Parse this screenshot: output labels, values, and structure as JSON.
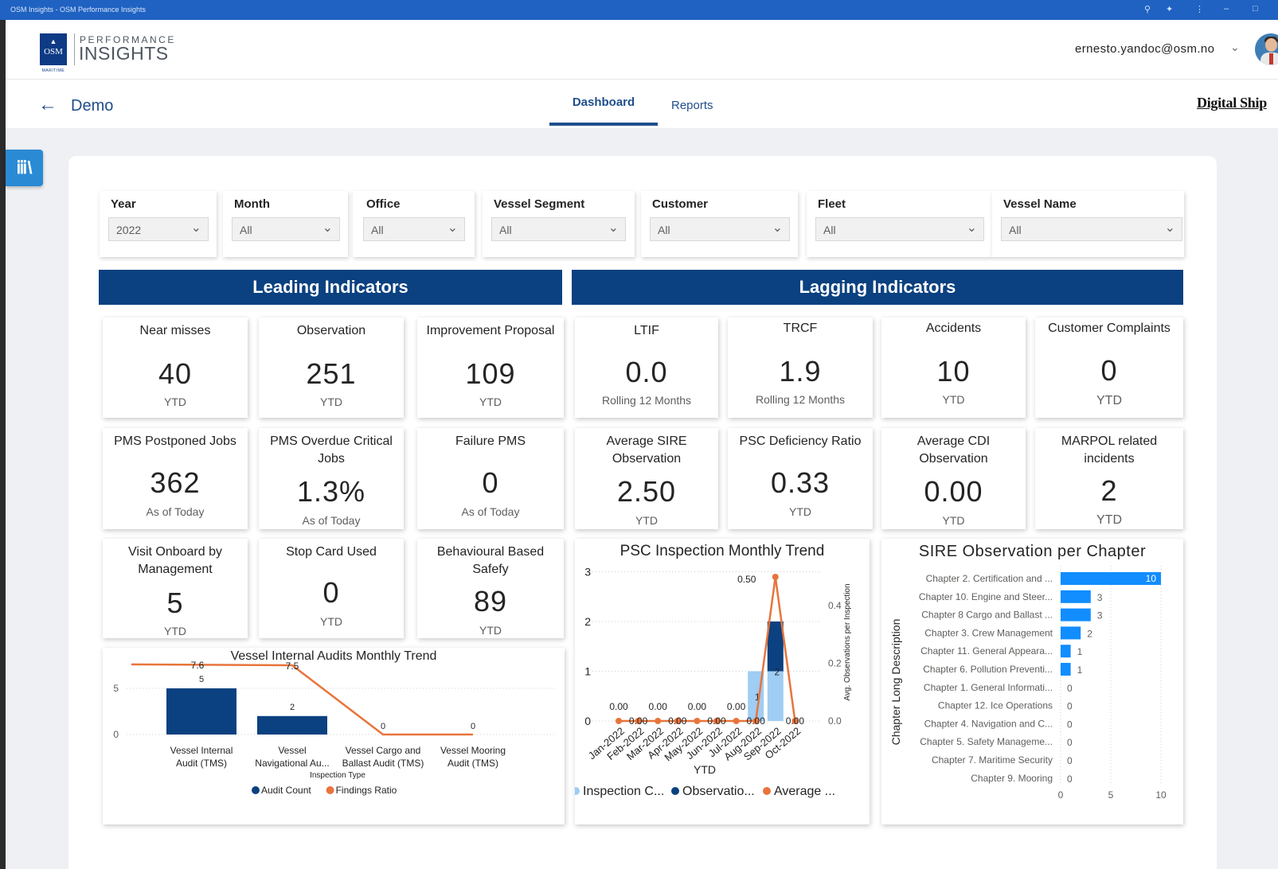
{
  "window": {
    "title": "OSM Insights - OSM Performance Insights"
  },
  "header": {
    "logo": {
      "mark": "OSM",
      "maritime": "MARITIME",
      "line1": "PERFORMANCE",
      "line2": "INSIGHTS"
    },
    "user_email": "ernesto.yandoc@osm.no"
  },
  "subnav": {
    "report_name": "Demo",
    "tabs": [
      "Dashboard",
      "Reports"
    ],
    "active_tab": "Dashboard",
    "partner_logo": "Digital Ship"
  },
  "slicers": [
    {
      "title": "Year",
      "value": "2022"
    },
    {
      "title": "Month",
      "value": "All"
    },
    {
      "title": "Office",
      "value": "All"
    },
    {
      "title": "Vessel Segment",
      "value": "All"
    },
    {
      "title": "Customer",
      "value": "All"
    },
    {
      "title": "Fleet",
      "value": "All"
    },
    {
      "title": "Vessel Name",
      "value": "All"
    }
  ],
  "sections": {
    "leading": "Leading Indicators",
    "lagging": "Lagging Indicators"
  },
  "kpis": {
    "near_misses": {
      "title": "Near misses",
      "value": "40",
      "sub": "YTD"
    },
    "observation": {
      "title": "Observation",
      "value": "251",
      "sub": "YTD"
    },
    "improvement": {
      "title": "Improvement Proposal",
      "value": "109",
      "sub": "YTD"
    },
    "ltif": {
      "title": "LTIF",
      "value": "0.0",
      "sub": "Rolling 12 Months"
    },
    "trcf": {
      "title": "TRCF",
      "value": "1.9",
      "sub": "Rolling 12 Months"
    },
    "accidents": {
      "title": "Accidents",
      "value": "10",
      "sub": "YTD"
    },
    "complaints": {
      "title": "Customer Complaints",
      "value": "0",
      "sub": "YTD"
    },
    "pms_postponed": {
      "title": "PMS Postponed Jobs",
      "value": "362",
      "sub": "As of Today"
    },
    "pms_overdue": {
      "title": "PMS Overdue Critical Jobs",
      "value": "1.3%",
      "sub": "As of Today"
    },
    "failure_pms": {
      "title": "Failure PMS",
      "value": "0",
      "sub": "As of Today"
    },
    "avg_sire": {
      "title": "Average SIRE Observation",
      "value": "2.50",
      "sub": "YTD"
    },
    "psc_ratio": {
      "title": "PSC Deficiency Ratio",
      "value": "0.33",
      "sub": "YTD"
    },
    "avg_cdi": {
      "title": "Average CDI Observation",
      "value": "0.00",
      "sub": "YTD"
    },
    "marpol": {
      "title": "MARPOL related incidents",
      "value": "2",
      "sub": "YTD"
    },
    "visit": {
      "title": "Visit Onboard by Management",
      "value": "5",
      "sub": "YTD"
    },
    "stop_card": {
      "title": "Stop Card Used",
      "value": "0",
      "sub": "YTD"
    },
    "bbs": {
      "title": "Behavioural Based Safefy",
      "value": "89",
      "sub": "YTD"
    }
  },
  "chart_data": [
    {
      "id": "audits",
      "type": "bar",
      "title": "Vessel Internal Audits Monthly Trend",
      "xlabel": "Inspection Type",
      "categories": [
        "Vessel Internal Audit (TMS)",
        "Vessel Navigational Au...",
        "Vessel Cargo and Ballast Audit (TMS)",
        "Vessel Mooring Audit (TMS)"
      ],
      "category_lines": [
        [
          "Vessel Internal",
          "Audit (TMS)"
        ],
        [
          "Vessel",
          "Navigational Au..."
        ],
        [
          "Vessel Cargo and",
          "Ballast Audit (TMS)"
        ],
        [
          "Vessel Mooring",
          "Audit (TMS)"
        ]
      ],
      "series": [
        {
          "name": "Audit Count",
          "type": "bar",
          "color": "#0b4180",
          "values": [
            5,
            2,
            0,
            0
          ],
          "labels": [
            "5",
            "2",
            "0",
            "0"
          ]
        },
        {
          "name": "Findings Ratio",
          "type": "line",
          "color": "#e8743b",
          "values": [
            7.6,
            7.5,
            0,
            0
          ],
          "labels": [
            "7.6",
            "7.5",
            "",
            ""
          ]
        }
      ],
      "yticks": [
        0,
        5
      ],
      "ylim": [
        0,
        8
      ]
    },
    {
      "id": "psc",
      "type": "bar",
      "title": "PSC Inspection Monthly Trend",
      "xlabel": "YTD",
      "y2label": "Avg. Observations per Inspection",
      "categories": [
        "Jan-2022",
        "Feb-2022",
        "Mar-2022",
        "Apr-2022",
        "May-2022",
        "Jun-2022",
        "Jul-2022",
        "Aug-2022",
        "Sep-2022",
        "Oct-2022"
      ],
      "series": [
        {
          "name": "Inspection C...",
          "type": "bar",
          "color": "#9fcdf3",
          "values": [
            0,
            0,
            0,
            0,
            0,
            0,
            0,
            1,
            2,
            0
          ],
          "labels": [
            "",
            "",
            "",
            "",
            "",
            "",
            "",
            "1",
            "2",
            ""
          ]
        },
        {
          "name": "Observatio...",
          "type": "bar",
          "color": "#0b4180",
          "values": [
            0,
            0,
            0,
            0,
            0,
            0,
            0,
            0,
            1,
            0
          ]
        },
        {
          "name": "Average ...",
          "type": "line",
          "color": "#e8743b",
          "axis": "secondary",
          "values": [
            0,
            0,
            0,
            0,
            0,
            0,
            0,
            0,
            0.5,
            0
          ],
          "labels": [
            "0.00",
            "0.00",
            "0.00",
            "0.00",
            "0.00",
            "0.00",
            "0.00",
            "0.00",
            "0.50",
            "0.00"
          ]
        }
      ],
      "yticks": [
        0,
        1,
        2,
        3
      ],
      "ylim": [
        0,
        3
      ],
      "y2ticks": [
        "0.0",
        "0.2",
        "0.4"
      ],
      "y2lim": [
        0,
        0.5
      ]
    },
    {
      "id": "sire",
      "type": "bar",
      "orientation": "horizontal",
      "title": "SIRE Observation per Chapter",
      "ylabel": "Chapter Long Description",
      "categories": [
        "Chapter 2. Certification and ...",
        "Chapter 10. Engine and Steer...",
        "Chapter 8 Cargo and Ballast ...",
        "Chapter 3. Crew Management",
        "Chapter 11. General Appeara...",
        "Chapter 6. Pollution Preventi...",
        "Chapter 1. General Informati...",
        "Chapter 12. Ice Operations",
        "Chapter 4. Navigation and C...",
        "Chapter 5. Safety Manageme...",
        "Chapter 7. Maritime Security",
        "Chapter 9. Mooring"
      ],
      "series": [
        {
          "name": "Observations",
          "color": "#118dff",
          "values": [
            10,
            3,
            3,
            2,
            1,
            1,
            0,
            0,
            0,
            0,
            0,
            0
          ]
        }
      ],
      "xticks": [
        0,
        5,
        10
      ],
      "xlim": [
        0,
        10
      ]
    }
  ]
}
